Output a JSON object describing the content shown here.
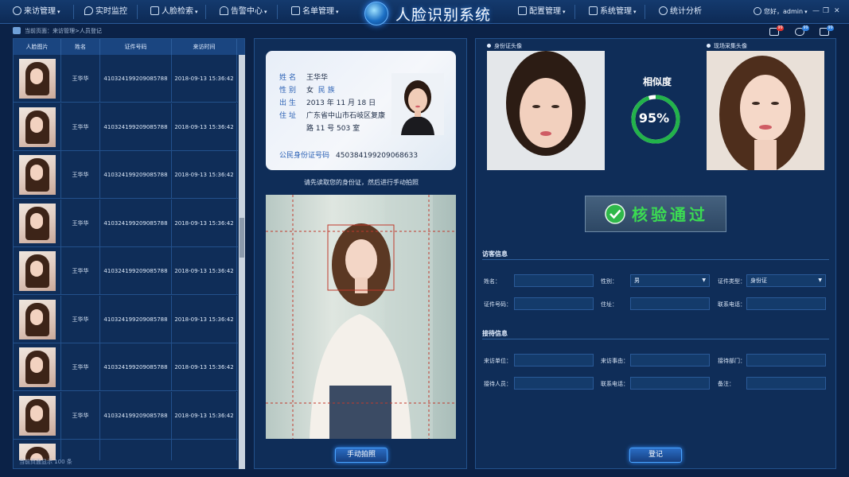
{
  "app": {
    "title": "人脸识别系统"
  },
  "nav": {
    "items": [
      {
        "label": "来访管理",
        "icon": "user-icon"
      },
      {
        "label": "实时监控",
        "icon": "location-icon"
      },
      {
        "label": "人脸检索",
        "icon": "face-search-icon"
      },
      {
        "label": "告警中心",
        "icon": "alarm-icon"
      },
      {
        "label": "名单管理",
        "icon": "list-icon"
      },
      {
        "label": "配置管理",
        "icon": "config-icon"
      },
      {
        "label": "系统管理",
        "icon": "system-icon"
      },
      {
        "label": "统计分析",
        "icon": "chart-icon"
      }
    ],
    "user": "您好，admin"
  },
  "breadcrumb": "当前页面：来访管理>人员登记",
  "badges": [
    "99",
    "99",
    "99"
  ],
  "table": {
    "headers": [
      "人脸图片",
      "姓名",
      "证件号码",
      "来访时间"
    ],
    "rows": [
      {
        "name": "王华华",
        "id": "410324199209085788",
        "time": "2018-09-13  15:36:42"
      },
      {
        "name": "王华华",
        "id": "410324199209085788",
        "time": "2018-09-13  15:36:42"
      },
      {
        "name": "王华华",
        "id": "410324199209085788",
        "time": "2018-09-13  15:36:42"
      },
      {
        "name": "王华华",
        "id": "410324199209085788",
        "time": "2018-09-13  15:36:42"
      },
      {
        "name": "王华华",
        "id": "410324199209085788",
        "time": "2018-09-13  15:36:42"
      },
      {
        "name": "王华华",
        "id": "410324199209085788",
        "time": "2018-09-13  15:36:42"
      },
      {
        "name": "王华华",
        "id": "410324199209085788",
        "time": "2018-09-13  15:36:42"
      },
      {
        "name": "王华华",
        "id": "410324199209085788",
        "time": "2018-09-13  15:36:42"
      },
      {
        "name": "王华华",
        "id": "410324199209085788",
        "time": "2018-09-13  15:36:42"
      }
    ],
    "footer": "当前页面显示 100 条"
  },
  "idcard": {
    "name_label": "姓名",
    "name": "王华华",
    "gender_label": "性别",
    "gender": "女",
    "ethnic_label": "民族",
    "ethnic": "",
    "birth_label": "出生",
    "birth": "2013 年 11 月 18 日",
    "addr_label": "住址",
    "addr1": "广东省中山市石岐区复康",
    "addr2": "路 11 号 503 室",
    "idno_label": "公民身份证号码",
    "idno": "450384199209068633"
  },
  "middle": {
    "hint": "请先读取您的身份证，然后进行手动拍照",
    "capture_button": "手动拍照"
  },
  "right": {
    "id_photo_label": "身份证头像",
    "live_photo_label": "现场采集头像",
    "similarity_title": "相似度",
    "similarity": "95%",
    "similarity_fraction": 0.95,
    "result": "核验通过",
    "visitor_section": "访客信息",
    "reception_section": "接待信息",
    "fields": {
      "name": "姓名：",
      "gender": "性别：",
      "gender_value": "男",
      "doc_type": "证件类型：",
      "doc_type_value": "身份证",
      "doc_no": "证件号码：",
      "address": "住址：",
      "phone": "联系电话：",
      "unit": "来访单位：",
      "reason": "来访事由：",
      "dept": "接待部门：",
      "host": "接待人员：",
      "host_phone": "联系电话：",
      "note": "备注："
    },
    "register_button": "登记"
  },
  "colors": {
    "accent": "#2f8cff",
    "pass": "#3bdc52",
    "progress": "#22b34a"
  }
}
